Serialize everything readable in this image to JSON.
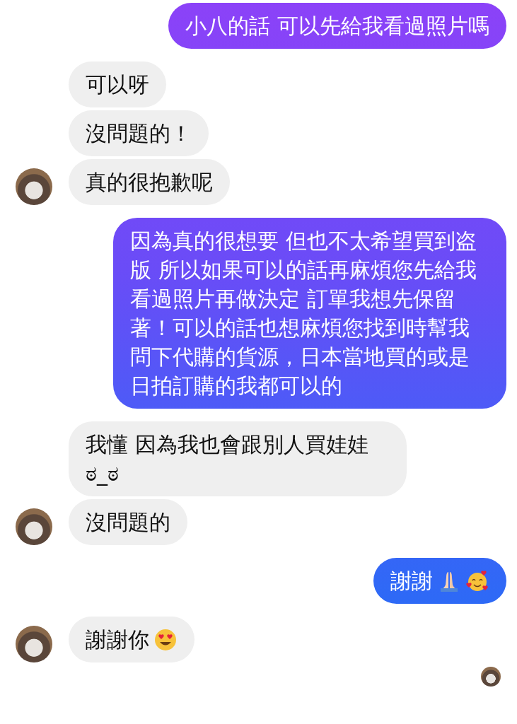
{
  "messages": [
    {
      "kind": "outgoing",
      "text": "小八的話 可以先給我看過照片嗎",
      "avatar": false
    },
    {
      "kind": "incoming",
      "text": "可以呀",
      "avatar": false
    },
    {
      "kind": "incoming",
      "text": "沒問題的！",
      "avatar": false
    },
    {
      "kind": "incoming",
      "text": "真的很抱歉呢",
      "avatar": true
    },
    {
      "kind": "outgoing",
      "text": "因為真的很想要 但也不太希望買到盗版 所以如果可以的話再麻煩您先給我看過照片再做決定 訂單我想先保留著！可以的話也想麻煩您找到時幫我問下代購的貨源，日本當地買的或是日拍訂購的我都可以的",
      "avatar": false
    },
    {
      "kind": "incoming",
      "text": "我懂 因為我也會跟別人買娃娃 ಠ_ಠ",
      "avatar": false
    },
    {
      "kind": "incoming",
      "text": "沒問題的",
      "avatar": true
    },
    {
      "kind": "outgoing",
      "text": "謝謝",
      "avatar": false,
      "trailing_icons": [
        {
          "kind": "praying-hands"
        },
        {
          "kind": "smiling-face-with-hearts"
        }
      ]
    },
    {
      "kind": "incoming",
      "text": "謝謝你",
      "avatar": true,
      "trailing_icons": [
        {
          "kind": "heart-eyes-face"
        }
      ]
    }
  ],
  "seen_indicator": true
}
